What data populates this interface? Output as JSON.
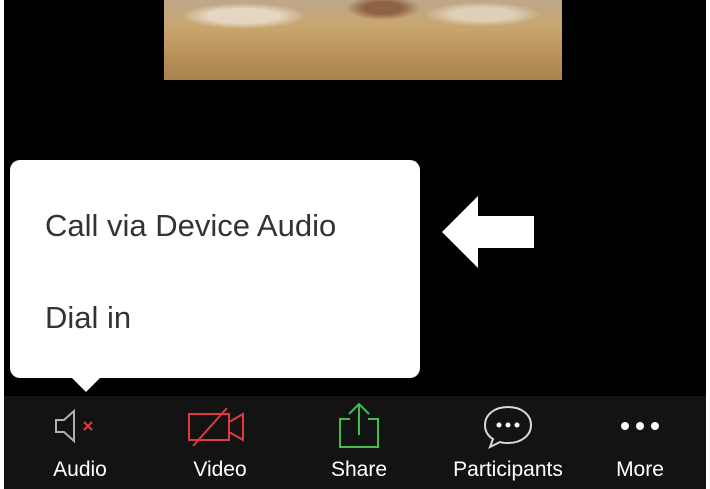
{
  "popup": {
    "items": [
      {
        "label": "Call via Device Audio"
      },
      {
        "label": "Dial in"
      }
    ]
  },
  "toolbar": {
    "audio": {
      "label": "Audio",
      "icon": "speaker-muted-icon"
    },
    "video": {
      "label": "Video",
      "icon": "video-off-icon"
    },
    "share": {
      "label": "Share",
      "icon": "share-upload-icon"
    },
    "participants": {
      "label": "Participants",
      "icon": "chat-bubble-icon"
    },
    "more": {
      "label": "More",
      "icon": "more-dots-icon"
    }
  },
  "colors": {
    "toolbar_bg": "#131313",
    "video_off": "#e0393e",
    "share": "#3fbf4a",
    "muted_x": "#e0393e",
    "icon_gray": "#b0b0b0"
  }
}
